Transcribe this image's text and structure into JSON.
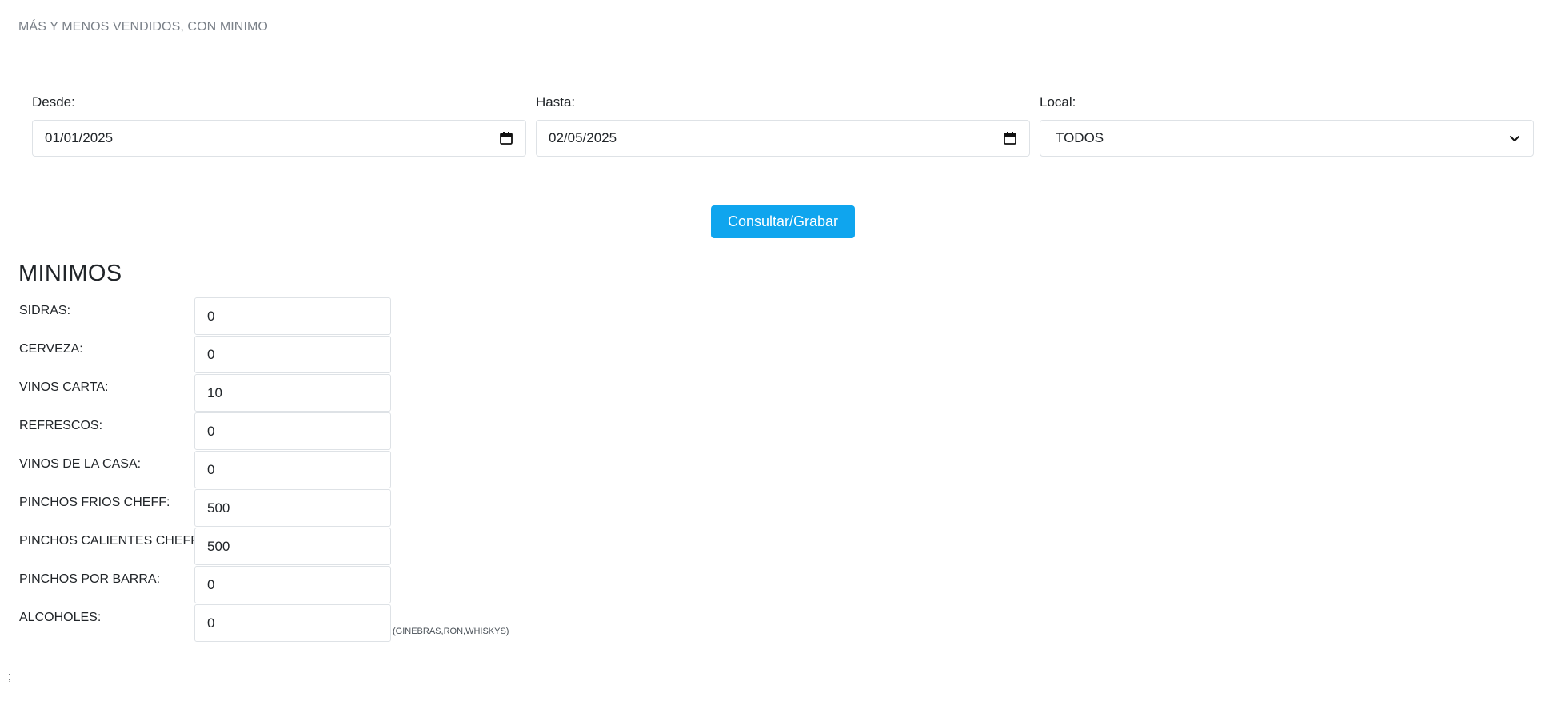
{
  "page": {
    "title": "MÁS Y MENOS VENDIDOS, CON MINIMO"
  },
  "filters": {
    "desde": {
      "label": "Desde:",
      "value": "01/01/2025"
    },
    "hasta": {
      "label": "Hasta:",
      "value": "02/05/2025"
    },
    "local": {
      "label": "Local:",
      "value": "TODOS"
    }
  },
  "actions": {
    "submit_label": "Consultar/Grabar"
  },
  "minimos": {
    "heading": "MINIMOS",
    "rows": [
      {
        "label": "SIDRAS:",
        "value": "0"
      },
      {
        "label": "CERVEZA:",
        "value": "0"
      },
      {
        "label": "VINOS CARTA:",
        "value": "10"
      },
      {
        "label": "REFRESCOS:",
        "value": "0"
      },
      {
        "label": "VINOS DE LA CASA:",
        "value": "0"
      },
      {
        "label": "PINCHOS FRIOS CHEFF:",
        "value": "500"
      },
      {
        "label": "PINCHOS CALIENTES CHEFF:",
        "value": "500"
      },
      {
        "label": "PINCHOS POR BARRA:",
        "value": "0"
      },
      {
        "label": "ALCOHOLES:",
        "value": "0",
        "hint": "(GINEBRAS,RON,WHISKYS)"
      }
    ]
  },
  "footer": {
    "text": ";"
  },
  "colors": {
    "accent": "#0fa5ee",
    "title_muted": "#7a8088",
    "border": "#dee2e6"
  },
  "icons": {
    "date_picker": "calendar-icon",
    "select": "chevron-down-icon"
  }
}
